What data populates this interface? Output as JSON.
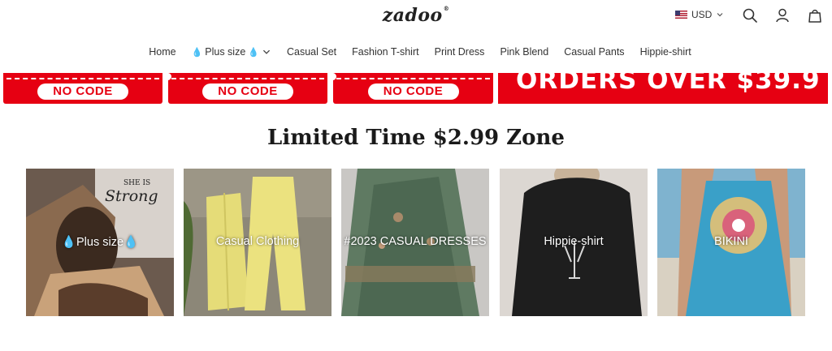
{
  "header": {
    "logo": "zadoo",
    "logo_mark": "®",
    "currency": "USD"
  },
  "nav": {
    "items": [
      "Home",
      "Plus size",
      "Casual Set",
      "Fashion T-shirt",
      "Print Dress",
      "Pink Blend",
      "Casual Pants",
      "Hippie-shirt"
    ]
  },
  "banners": {
    "coupon_label": "NO CODE",
    "orders_text": "ORDERS OVER $39.9"
  },
  "zone": {
    "title": "Limited Time $2.99 Zone"
  },
  "cards": [
    {
      "label": "Plus size",
      "note": "plus-size",
      "colors": [
        "#5a3d2b",
        "#c9a27a",
        "#3b2a1f",
        "#ffffff"
      ]
    },
    {
      "label": "Casual Clothing",
      "note": "casual",
      "colors": [
        "#8c8778",
        "#e8df7a",
        "#5a6b3a"
      ]
    },
    {
      "label": "#2023 CASUAL DRESSES",
      "note": "dresses",
      "colors": [
        "#5f7a62",
        "#3f5547",
        "#8a7a5c"
      ]
    },
    {
      "label": "Hippie-shirt",
      "note": "hippie",
      "colors": [
        "#d9d4cf",
        "#1e1e1e",
        "#c8b39a"
      ]
    },
    {
      "label": "BIKINI",
      "note": "bikini",
      "colors": [
        "#7fb3cf",
        "#f0c36d",
        "#d94b7c",
        "#3aa0c8"
      ]
    }
  ],
  "colors": {
    "banner_red": "#e60012",
    "plus_drop": "#f4b400"
  }
}
